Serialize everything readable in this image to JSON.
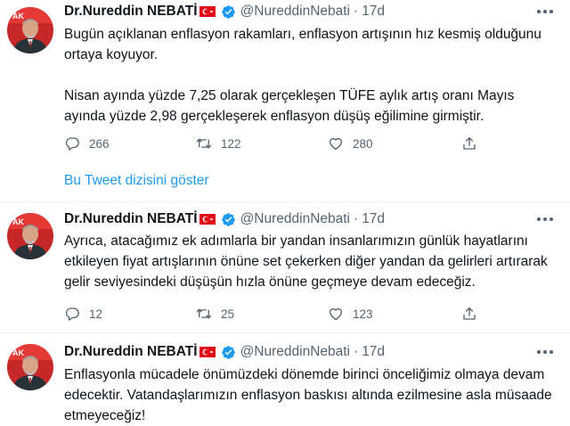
{
  "tweets": [
    {
      "name": "Dr.Nureddin NEBATİ",
      "handle": "@NureddinNebati",
      "dot": "·",
      "time": "17d",
      "paragraphs": [
        "Bugün açıklanan enflasyon rakamları, enflasyon artışının hız kesmiş olduğunu ortaya koyuyor.",
        "Nisan ayında yüzde 7,25 olarak gerçekleşen TÜFE aylık artış oranı Mayıs ayında yüzde 2,98 gerçekleşerek enflasyon düşüş eğilimine girmiştir."
      ],
      "replies": "266",
      "retweets": "122",
      "likes": "280"
    },
    {
      "name": "Dr.Nureddin NEBATİ",
      "handle": "@NureddinNebati",
      "dot": "·",
      "time": "17d",
      "paragraphs": [
        "Ayrıca, atacağımız ek adımlarla bir yandan insanlarımızın günlük hayatlarını etkileyen fiyat artışlarının önüne set çekerken diğer yandan da gelirleri artırarak gelir seviyesindeki düşüşün hızla önüne geçmeye devam edeceğiz."
      ],
      "replies": "12",
      "retweets": "25",
      "likes": "123"
    },
    {
      "name": "Dr.Nureddin NEBATİ",
      "handle": "@NureddinNebati",
      "dot": "·",
      "time": "17d",
      "paragraphs": [
        "Enflasyonla mücadele önümüzdeki dönemde birinci önceliğimiz olmaya devam edecektir. Vatandaşlarımızın enflasyon baskısı altında ezilmesine asla müsaade etmeyeceğiz!"
      ]
    }
  ],
  "show_thread_label": "Bu Tweet dizisini göster",
  "icons": {
    "reply": "reply-icon",
    "retweet": "retweet-icon",
    "like": "heart-icon",
    "share": "share-icon",
    "more": "more-icon",
    "verified": "verified-badge-icon",
    "flag": "turkey-flag-icon"
  },
  "colors": {
    "accent": "#1d9bf0",
    "secondary_text": "#536471",
    "flag_red": "#e30a17"
  }
}
